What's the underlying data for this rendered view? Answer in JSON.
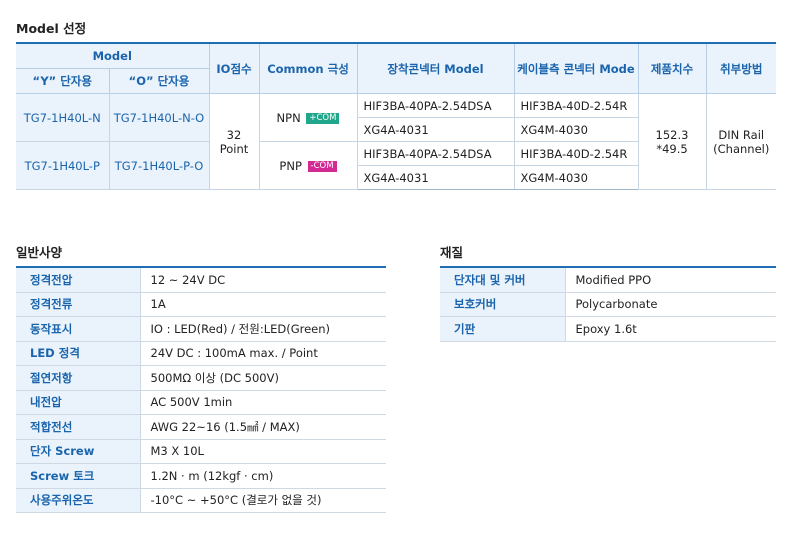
{
  "model_section": {
    "title": "Model 선정",
    "headers": {
      "model": "Model",
      "y_terminal": "“Y” 단자용",
      "o_terminal": "“O” 단자용",
      "io_points": "IO점수",
      "common_polarity": "Common 극성",
      "mounted_connector": "장착콘넥터 Model",
      "cable_connector": "케이블측 콘넥터 Mode",
      "dimensions": "제품치수",
      "mounting": "취부방법"
    },
    "rows": [
      {
        "y_model": "TG7-1H40L-N",
        "o_model": "TG7-1H40L-N-O",
        "polarity": "NPN",
        "com": "+COM",
        "mounted": [
          "HIF3BA-40PA-2.54DSA",
          "XG4A-4031"
        ],
        "cable": [
          "HIF3BA-40D-2.54R",
          "XG4M-4030"
        ]
      },
      {
        "y_model": "TG7-1H40L-P",
        "o_model": "TG7-1H40L-P-O",
        "polarity": "PNP",
        "com": "-COM",
        "mounted": [
          "HIF3BA-40PA-2.54DSA",
          "XG4A-4031"
        ],
        "cable": [
          "HIF3BA-40D-2.54R",
          "XG4M-4030"
        ]
      }
    ],
    "io_points_value": "32",
    "io_points_unit": "Point",
    "dimensions_value": "152.3 *49.5",
    "mounting_value_1": "DIN Rail",
    "mounting_value_2": "(Channel)"
  },
  "general_section": {
    "title": "일반사양",
    "rows": [
      {
        "key": "정격전압",
        "value": "12 ~ 24V DC"
      },
      {
        "key": "정격전류",
        "value": "1A"
      },
      {
        "key": "동작표시",
        "value": "IO : LED(Red) / 전원:LED(Green)"
      },
      {
        "key": "LED 정격",
        "value": "24V DC : 100mA max. / Point"
      },
      {
        "key": "절연저항",
        "value": "500MΩ 이상 (DC 500V)"
      },
      {
        "key": "내전압",
        "value": "AC 500V 1min"
      },
      {
        "key": "적합전선",
        "value": "AWG 22~16 (1.5㎟ / MAX)"
      },
      {
        "key": "단자 Screw",
        "value": "M3 X 10L"
      },
      {
        "key": "Screw 토크",
        "value": "1.2N · m (12kgf · cm)"
      },
      {
        "key": "사용주위온도",
        "value": "-10°C ~ +50°C (결로가 없을 것)"
      }
    ]
  },
  "material_section": {
    "title": "재질",
    "rows": [
      {
        "key": "단자대 및 커버",
        "value": "Modified PPO"
      },
      {
        "key": "보호커버",
        "value": "Polycarbonate"
      },
      {
        "key": "기판",
        "value": "Epoxy 1.6t"
      }
    ]
  },
  "colors": {
    "accent": "#1f6db5",
    "header_bg": "#eaf3fb",
    "plus_com": "#21a88c",
    "minus_com": "#d42a94"
  }
}
